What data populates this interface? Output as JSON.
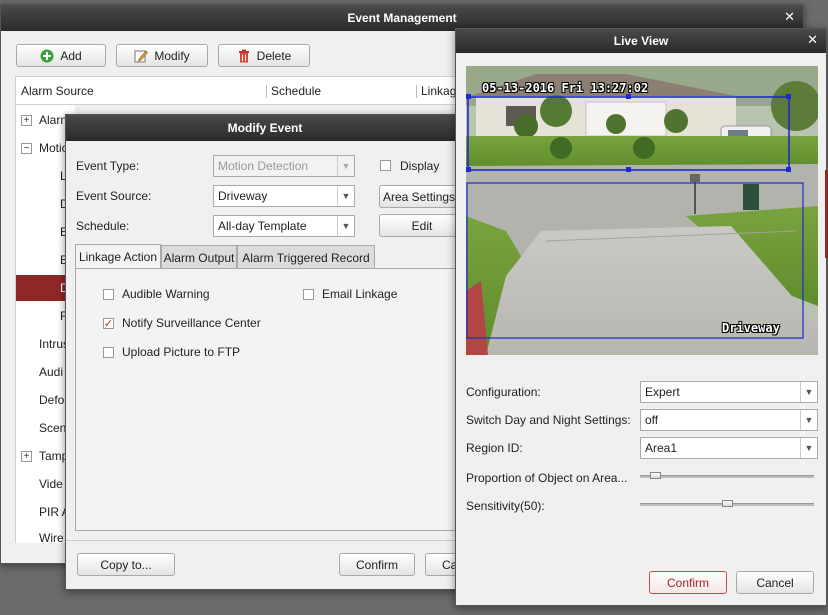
{
  "event_management": {
    "title": "Event Management",
    "toolbar": {
      "add": "Add",
      "modify": "Modify",
      "delete": "Delete"
    },
    "columns": {
      "alarm_source": "Alarm Source",
      "schedule": "Schedule",
      "linkage": "Linkag"
    },
    "tree": [
      {
        "label": "Alarn",
        "expander": "+"
      },
      {
        "label": "Motio",
        "expander": "−"
      },
      {
        "label": "L"
      },
      {
        "label": "D"
      },
      {
        "label": "E"
      },
      {
        "label": "E"
      },
      {
        "label": "D"
      },
      {
        "label": "F"
      },
      {
        "label": "Intrus"
      },
      {
        "label": "Audi"
      },
      {
        "label": "Defo"
      },
      {
        "label": "Scen"
      },
      {
        "label": "Tamp",
        "expander": "+"
      },
      {
        "label": "Vide"
      },
      {
        "label": "PIR A"
      },
      {
        "label": "Wire"
      }
    ]
  },
  "modify_event": {
    "title": "Modify Event",
    "event_type_label": "Event Type:",
    "event_type_value": "Motion Detection",
    "display_label": "Display",
    "event_source_label": "Event Source:",
    "event_source_value": "Driveway",
    "area_settings": "Area Settings",
    "schedule_label": "Schedule:",
    "schedule_value": "All-day Template",
    "edit": "Edit",
    "tabs": [
      "Linkage Action",
      "Alarm Output",
      "Alarm Triggered Record"
    ],
    "options": {
      "audible_warning": "Audible Warning",
      "email_linkage": "Email Linkage",
      "notify_center": "Notify Surveillance Center",
      "upload_ftp": "Upload Picture to FTP"
    },
    "copy_to": "Copy to...",
    "confirm": "Confirm",
    "cancel_partial": "Ca"
  },
  "live_view": {
    "title": "Live View",
    "timestamp": "05-13-2016 Fri 13:27:02",
    "camera_name": "Driveway",
    "configuration_label": "Configuration:",
    "configuration_value": "Expert",
    "daynight_label": "Switch Day and Night Settings:",
    "daynight_value": "off",
    "region_label": "Region ID:",
    "region_value": "Area1",
    "proportion_label": "Proportion of Object on Area...",
    "proportion_value": 0.06,
    "sensitivity_label": "Sensitivity(50):",
    "sensitivity_value": 0.5,
    "confirm": "Confirm",
    "cancel": "Cancel"
  },
  "colors": {
    "accent_red": "#a82323",
    "region_box": "#1b2bd1",
    "title_bar": "#333333"
  }
}
